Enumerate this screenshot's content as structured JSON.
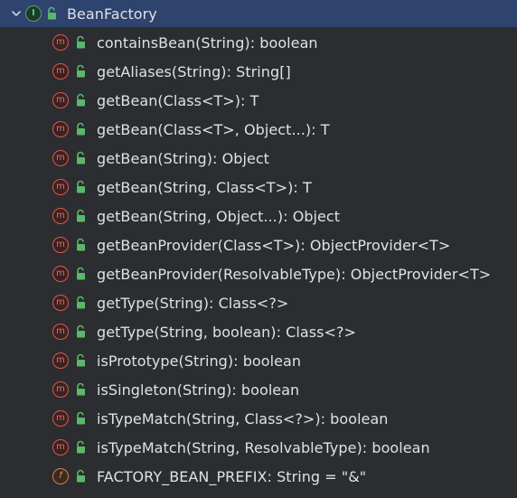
{
  "tree": {
    "root": {
      "label": "BeanFactory",
      "kind_icon": "interface-icon",
      "kind_letter": "I",
      "access_icon": "public-lock-icon"
    },
    "members": [
      {
        "label": "containsBean(String): boolean",
        "kind": "method",
        "letter": "m"
      },
      {
        "label": "getAliases(String): String[]",
        "kind": "method",
        "letter": "m"
      },
      {
        "label": "getBean(Class<T>): T",
        "kind": "method",
        "letter": "m"
      },
      {
        "label": "getBean(Class<T>, Object...): T",
        "kind": "method",
        "letter": "m"
      },
      {
        "label": "getBean(String): Object",
        "kind": "method",
        "letter": "m"
      },
      {
        "label": "getBean(String, Class<T>): T",
        "kind": "method",
        "letter": "m"
      },
      {
        "label": "getBean(String, Object...): Object",
        "kind": "method",
        "letter": "m"
      },
      {
        "label": "getBeanProvider(Class<T>): ObjectProvider<T>",
        "kind": "method",
        "letter": "m"
      },
      {
        "label": "getBeanProvider(ResolvableType): ObjectProvider<T>",
        "kind": "method",
        "letter": "m"
      },
      {
        "label": "getType(String): Class<?>",
        "kind": "method",
        "letter": "m"
      },
      {
        "label": "getType(String, boolean): Class<?>",
        "kind": "method",
        "letter": "m"
      },
      {
        "label": "isPrototype(String): boolean",
        "kind": "method",
        "letter": "m"
      },
      {
        "label": "isSingleton(String): boolean",
        "kind": "method",
        "letter": "m"
      },
      {
        "label": "isTypeMatch(String, Class<?>): boolean",
        "kind": "method",
        "letter": "m"
      },
      {
        "label": "isTypeMatch(String, ResolvableType): boolean",
        "kind": "method",
        "letter": "m"
      },
      {
        "label": "FACTORY_BEAN_PREFIX: String = \"&\"",
        "kind": "field",
        "letter": "f"
      }
    ]
  },
  "colors": {
    "background": "#2b2d30",
    "selection": "#2e436e",
    "text": "#dfe1e5",
    "method": "#e0554b",
    "field": "#d2804a",
    "interface": "#4ea86a",
    "lock": "#5bb86a"
  }
}
